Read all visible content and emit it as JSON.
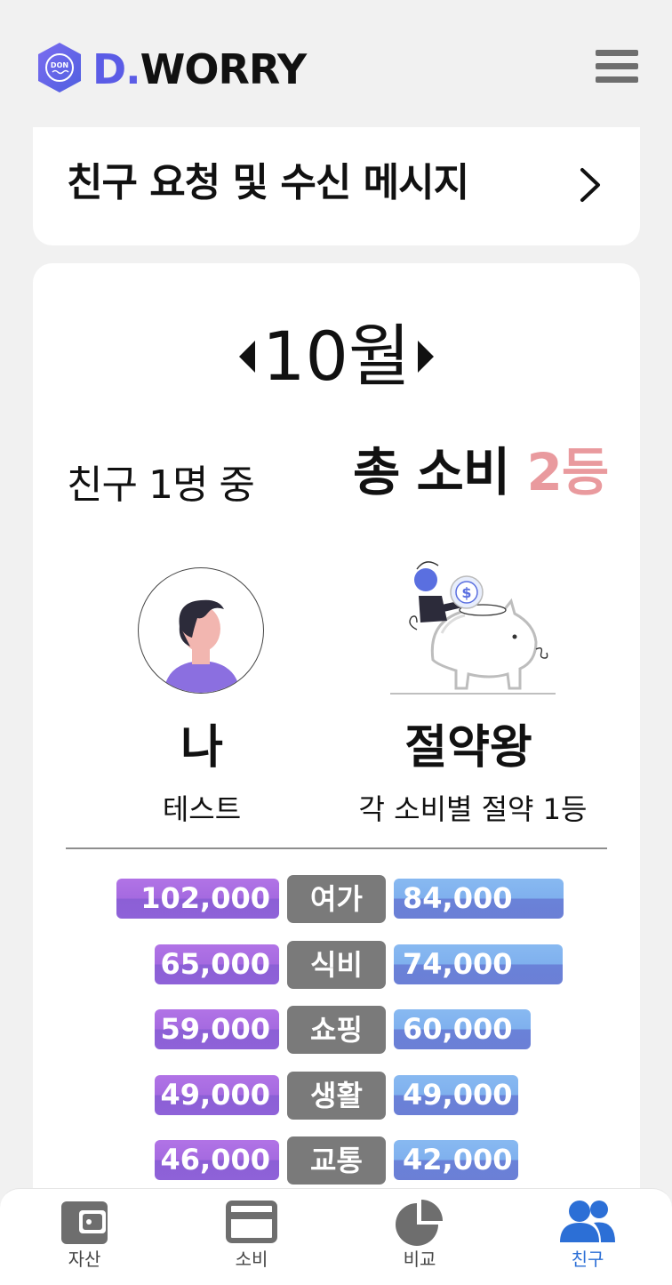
{
  "header": {
    "logo_badge": "DON",
    "logo_d": "D.",
    "logo_rest": "WORRY"
  },
  "friend_request": {
    "title": "친구 요청 및 수신 메시지"
  },
  "month": {
    "label": "10월"
  },
  "ranking": {
    "friends_text": "친구 1명 중",
    "total_label": "총 소비",
    "rank": "2등"
  },
  "me": {
    "name": "나",
    "subtitle": "테스트"
  },
  "champion": {
    "title": "절약왕",
    "subtitle": "각 소비별 절약 1등"
  },
  "comparison": [
    {
      "category": "여가",
      "mine": "102,000",
      "champion": "84,000",
      "mine_value": 102000,
      "champion_value": 84000
    },
    {
      "category": "식비",
      "mine": "65,000",
      "champion": "74,000",
      "mine_value": 65000,
      "champion_value": 74000
    },
    {
      "category": "쇼핑",
      "mine": "59,000",
      "champion": "60,000",
      "mine_value": 59000,
      "champion_value": 60000
    },
    {
      "category": "생활",
      "mine": "49,000",
      "champion": "49,000",
      "mine_value": 49000,
      "champion_value": 49000
    },
    {
      "category": "교통",
      "mine": "46,000",
      "champion": "42,000",
      "mine_value": 46000,
      "champion_value": 42000
    }
  ],
  "bottom_nav": [
    {
      "label": "자산",
      "icon": "wallet-icon",
      "active": false
    },
    {
      "label": "소비",
      "icon": "credit-card-icon",
      "active": false
    },
    {
      "label": "비교",
      "icon": "pie-chart-icon",
      "active": false
    },
    {
      "label": "친구",
      "icon": "users-icon",
      "active": true
    }
  ],
  "colors": {
    "brand": "#5b5ce6",
    "rank": "#e99a9e",
    "mine_bar": "#a56ae0",
    "champion_bar": "#7fb0ee",
    "category_chip": "#7a7a7a",
    "active_nav": "#2c6fd6"
  }
}
